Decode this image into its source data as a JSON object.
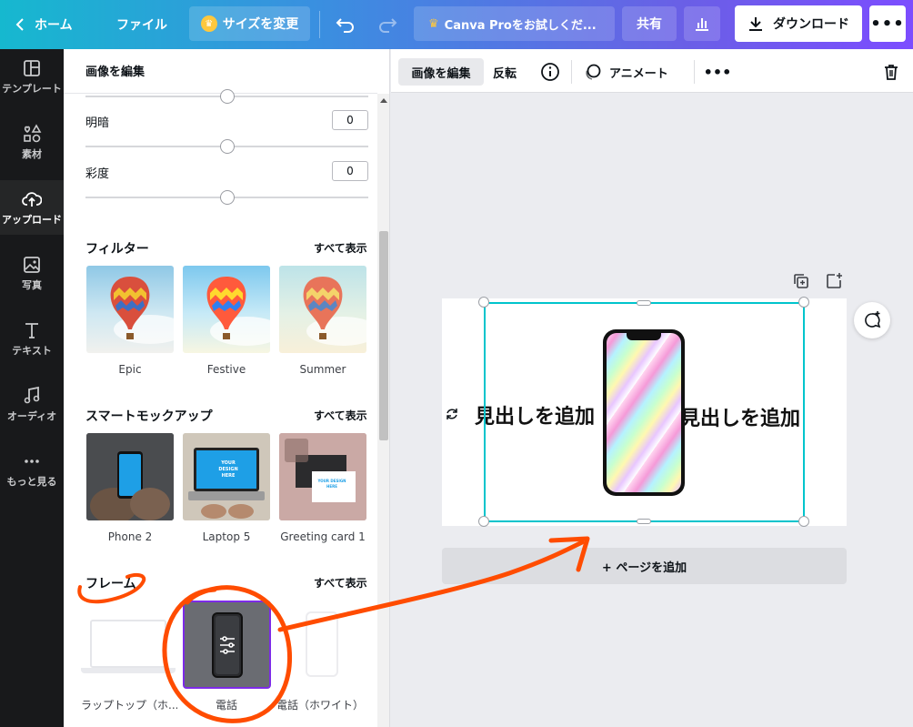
{
  "topbar": {
    "home": "ホーム",
    "file": "ファイル",
    "resize": "サイズを変更",
    "pro_trial": "Canva Proをお試しくだ...",
    "share": "共有",
    "download": "ダウンロード",
    "more": "•••"
  },
  "rail": {
    "items": [
      {
        "label": "テンプレート",
        "icon": "template-icon"
      },
      {
        "label": "素材",
        "icon": "elements-icon"
      },
      {
        "label": "アップロード",
        "icon": "upload-icon"
      },
      {
        "label": "写真",
        "icon": "photo-icon"
      },
      {
        "label": "テキスト",
        "icon": "text-icon"
      },
      {
        "label": "オーディオ",
        "icon": "audio-icon"
      },
      {
        "label": "もっと見る",
        "icon": "more-icon"
      }
    ]
  },
  "panel": {
    "title": "画像を編集",
    "brightness_label": "明暗",
    "brightness_value": "0",
    "saturation_label": "彩度",
    "saturation_value": "0",
    "filters_title": "フィルター",
    "see_all": "すべて表示",
    "filters": [
      "Epic",
      "Festive",
      "Summer"
    ],
    "mockups_title": "スマートモックアップ",
    "mockups": [
      "Phone 2",
      "Laptop 5",
      "Greeting card 1"
    ],
    "frames_title": "フレーム",
    "frames": [
      "ラップトップ（ホ...",
      "電話",
      "電話（ホワイト）"
    ],
    "mockup_screen_text": "YOUR DESIGN HERE"
  },
  "context_toolbar": {
    "edit_image": "画像を編集",
    "flip": "反転",
    "animate": "アニメート",
    "more": "•••"
  },
  "canvas": {
    "heading_left": "見出しを追加",
    "heading_right": "見出しを追加",
    "add_page": "+ ページを追加"
  },
  "colors": {
    "accent": "#00c4cc",
    "selected_frame": "#7d2ae8",
    "annotation": "#ff4c00"
  }
}
